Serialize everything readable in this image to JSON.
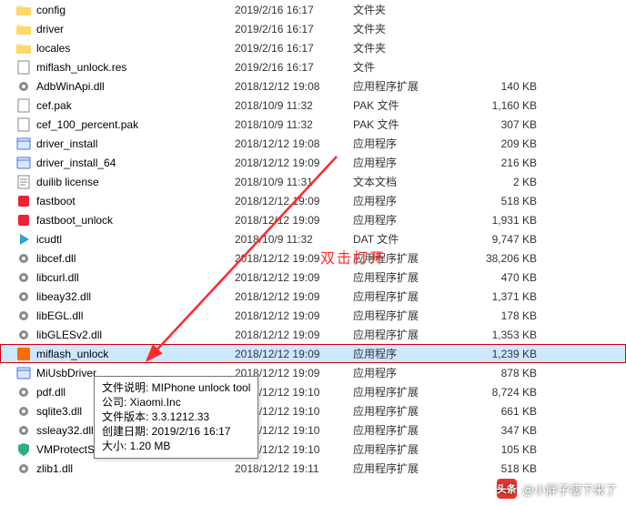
{
  "annotation": "双击打开",
  "tooltip": {
    "line1": "文件说明: MIPhone unlock tool",
    "line2": "公司: Xiaomi.Inc",
    "line3": "文件版本: 3.3.1212.33",
    "line4": "创建日期: 2019/2/16 16:17",
    "line5": "大小: 1.20 MB"
  },
  "watermark": {
    "badge": "头条",
    "text": "@小胖子瘦下来了"
  },
  "files": [
    {
      "icon": "folder",
      "name": "config",
      "date": "2019/2/16 16:17",
      "type": "文件夹",
      "size": ""
    },
    {
      "icon": "folder",
      "name": "driver",
      "date": "2019/2/16 16:17",
      "type": "文件夹",
      "size": ""
    },
    {
      "icon": "folder",
      "name": "locales",
      "date": "2019/2/16 16:17",
      "type": "文件夹",
      "size": ""
    },
    {
      "icon": "file",
      "name": "miflash_unlock.res",
      "date": "2019/2/16 16:17",
      "type": "文件",
      "size": ""
    },
    {
      "icon": "dll",
      "name": "AdbWinApi.dll",
      "date": "2018/12/12 19:08",
      "type": "应用程序扩展",
      "size": "140 KB"
    },
    {
      "icon": "file",
      "name": "cef.pak",
      "date": "2018/10/9 11:32",
      "type": "PAK 文件",
      "size": "1,160 KB"
    },
    {
      "icon": "file",
      "name": "cef_100_percent.pak",
      "date": "2018/10/9 11:32",
      "type": "PAK 文件",
      "size": "307 KB"
    },
    {
      "icon": "app",
      "name": "driver_install",
      "date": "2018/12/12 19:08",
      "type": "应用程序",
      "size": "209 KB"
    },
    {
      "icon": "app",
      "name": "driver_install_64",
      "date": "2018/12/12 19:09",
      "type": "应用程序",
      "size": "216 KB"
    },
    {
      "icon": "txt",
      "name": "duilib license",
      "date": "2018/10/9 11:31",
      "type": "文本文档",
      "size": "2 KB"
    },
    {
      "icon": "fastboot",
      "name": "fastboot",
      "date": "2018/12/12 19:09",
      "type": "应用程序",
      "size": "518 KB"
    },
    {
      "icon": "fastboot",
      "name": "fastboot_unlock",
      "date": "2018/12/12 19:09",
      "type": "应用程序",
      "size": "1,931 KB"
    },
    {
      "icon": "play",
      "name": "icudtl",
      "date": "2018/10/9 11:32",
      "type": "DAT 文件",
      "size": "9,747 KB"
    },
    {
      "icon": "dll",
      "name": "libcef.dll",
      "date": "2018/12/12 19:09",
      "type": "应用程序扩展",
      "size": "38,206 KB"
    },
    {
      "icon": "dll",
      "name": "libcurl.dll",
      "date": "2018/12/12 19:09",
      "type": "应用程序扩展",
      "size": "470 KB"
    },
    {
      "icon": "dll",
      "name": "libeay32.dll",
      "date": "2018/12/12 19:09",
      "type": "应用程序扩展",
      "size": "1,371 KB"
    },
    {
      "icon": "dll",
      "name": "libEGL.dll",
      "date": "2018/12/12 19:09",
      "type": "应用程序扩展",
      "size": "178 KB"
    },
    {
      "icon": "dll",
      "name": "libGLESv2.dll",
      "date": "2018/12/12 19:09",
      "type": "应用程序扩展",
      "size": "1,353 KB"
    },
    {
      "icon": "mi",
      "name": "miflash_unlock",
      "date": "2018/12/12 19:09",
      "type": "应用程序",
      "size": "1,239 KB",
      "selected": true,
      "highlighted": true
    },
    {
      "icon": "app",
      "name": "MiUsbDriver",
      "date": "2018/12/12 19:09",
      "type": "应用程序",
      "size": "878 KB"
    },
    {
      "icon": "dll",
      "name": "pdf.dll",
      "date": "2018/12/12 19:10",
      "type": "应用程序扩展",
      "size": "8,724 KB"
    },
    {
      "icon": "dll",
      "name": "sqlite3.dll",
      "date": "2018/12/12 19:10",
      "type": "应用程序扩展",
      "size": "661 KB"
    },
    {
      "icon": "dll",
      "name": "ssleay32.dll",
      "date": "2018/12/12 19:10",
      "type": "应用程序扩展",
      "size": "347 KB"
    },
    {
      "icon": "shield",
      "name": "VMProtectSDK32.dll",
      "date": "2018/12/12 19:10",
      "type": "应用程序扩展",
      "size": "105 KB"
    },
    {
      "icon": "dll",
      "name": "zlib1.dll",
      "date": "2018/12/12 19:11",
      "type": "应用程序扩展",
      "size": "518 KB"
    }
  ]
}
